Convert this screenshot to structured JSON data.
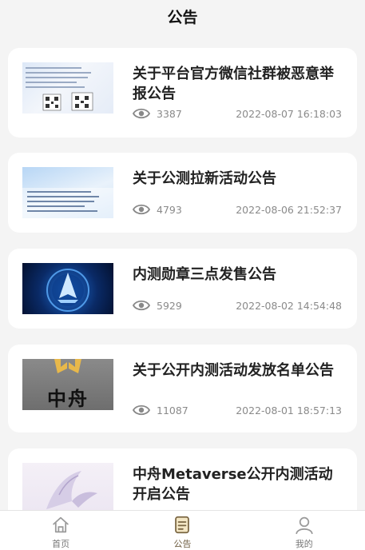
{
  "header": {
    "title": "公告"
  },
  "thumbs": {
    "t1": "平台官方微信社群",
    "t2": "拉新活动",
    "t2_sub": "邀请好友有奖",
    "t4": "中舟"
  },
  "announcements": [
    {
      "title": "关于平台官方微信社群被恶意举报公告",
      "views": "3387",
      "date": "2022-08-07 16:18:03"
    },
    {
      "title": "关于公测拉新活动公告",
      "views": "4793",
      "date": "2022-08-06 21:52:37"
    },
    {
      "title": "内测勋章三点发售公告",
      "views": "5929",
      "date": "2022-08-02 14:54:48"
    },
    {
      "title": "关于公开内测活动发放名单公告",
      "views": "11087",
      "date": "2022-08-01 18:57:13"
    },
    {
      "title": "中舟Metaverse公开内测活动开启公告",
      "views": "",
      "date": ""
    }
  ],
  "tabbar": {
    "items": [
      {
        "label": "首页",
        "icon": "home-icon"
      },
      {
        "label": "公告",
        "icon": "notice-icon",
        "active": true
      },
      {
        "label": "我的",
        "icon": "user-icon"
      }
    ]
  },
  "colors": {
    "active_tab": "#6b5a3d",
    "inactive_tab": "#9a9a9a",
    "background": "#f4f4f4"
  }
}
